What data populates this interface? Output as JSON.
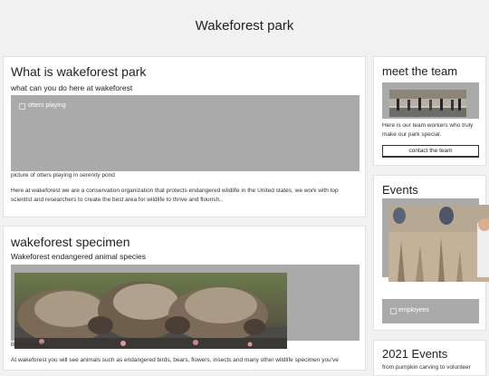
{
  "header": {
    "title": "Wakeforest park"
  },
  "about": {
    "heading": "What is wakeforest park",
    "subheading": "what can you do here at wakeforest",
    "image_alt": "otters playing",
    "caption": "picture of otters playing in serenity pond",
    "body": "Here at wakeforest we are a conservation organization that protects endangered wildlife in the United states, we work with top scientist and researchers to create the best area for wildlife to thrive and flourish.."
  },
  "specimen": {
    "heading": "wakeforest specimen",
    "subheading": "Wakeforest endangered animal species",
    "caption": "Bears eating",
    "body": "At wakeforest you will see animals such as endangered birds, bears, flowers, insects and many other wildlife specimen you've"
  },
  "team": {
    "heading": "meet the team",
    "body": "Here is our team workers who truly make our park special.",
    "button_label": "contact the team"
  },
  "events": {
    "heading": "Events",
    "image_alt": "employees"
  },
  "events2021": {
    "heading": "2021 Events",
    "body": "from pumpkin carving to volunteer"
  }
}
